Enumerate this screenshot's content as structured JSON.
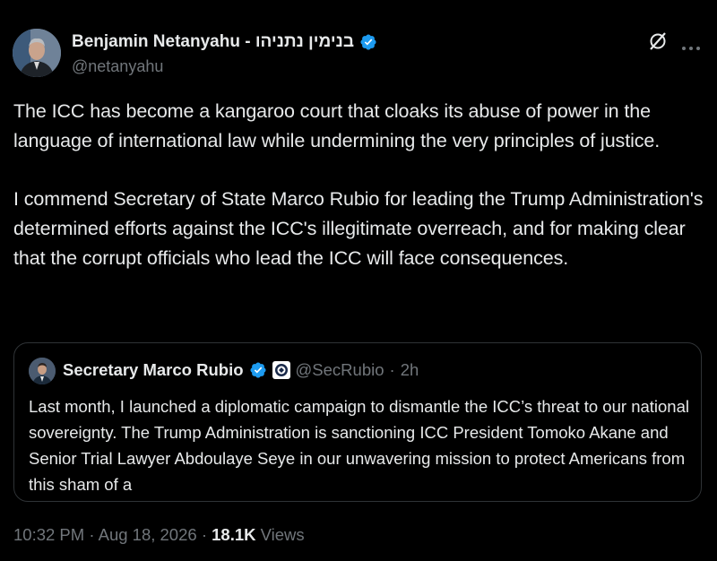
{
  "author": {
    "name": "Benjamin Netanyahu - בנימין נתניהו",
    "handle": "@netanyahu"
  },
  "icons": {
    "verified": "verified-badge-icon",
    "grok": "grok-icon",
    "more": "more-options-icon"
  },
  "tweet": {
    "paragraphs": [
      "The ICC has become a kangaroo court that cloaks its abuse of power in the language of international law while undermining the very principles of justice.",
      "I commend Secretary of State Marco Rubio for leading the Trump Administration's determined efforts against the ICC's illegitimate overreach, and for making clear that the corrupt officials who lead the ICC will face consequences."
    ]
  },
  "quote": {
    "name": "Secretary Marco Rubio",
    "handle": "@SecRubio",
    "separator": "·",
    "time": "2h",
    "text": "Last month, I launched a diplomatic campaign to dismantle the ICC’s threat to our national sovereignty. The Trump Administration is sanctioning ICC President Tomoko Akane and Senior Trial Lawyer Abdoulaye Seye in our unwavering mission to protect Americans from this sham of a"
  },
  "footer": {
    "timestamp": "10:32 PM · Aug 18, 2026 ·",
    "views_count": "18.1K",
    "views_label": "Views"
  },
  "colors": {
    "background": "#000000",
    "text": "#e7e9ea",
    "muted": "#71767b",
    "verified_blue": "#1d9bf0",
    "border": "#2f3336"
  }
}
